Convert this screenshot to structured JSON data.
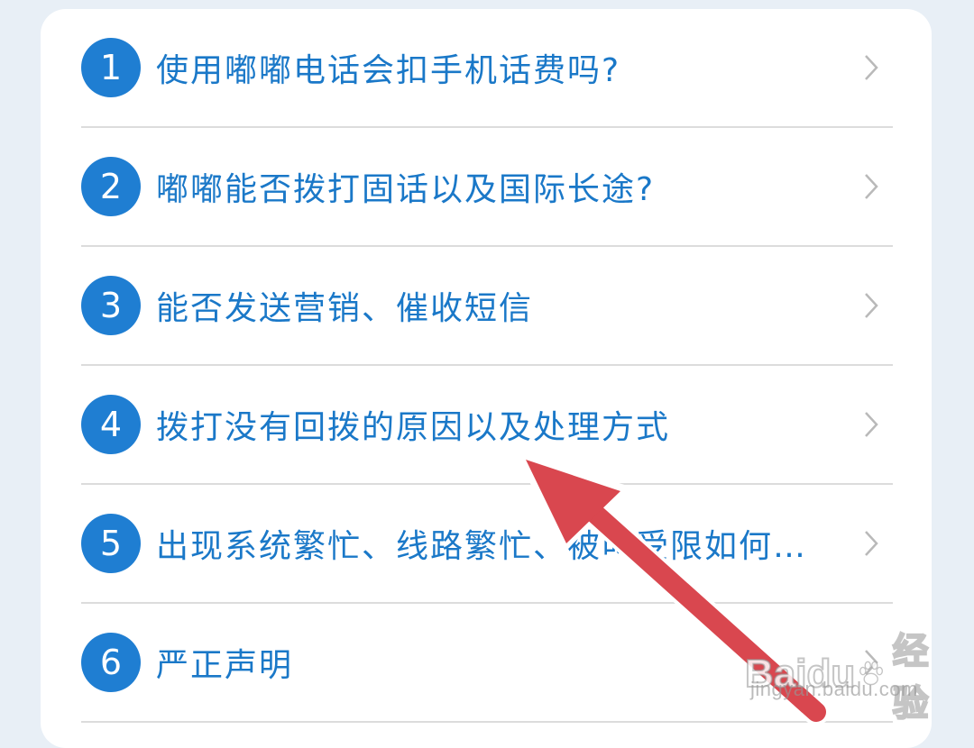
{
  "faq": {
    "items": [
      {
        "number": "1",
        "title": "使用嘟嘟电话会扣手机话费吗?"
      },
      {
        "number": "2",
        "title": "嘟嘟能否拨打固话以及国际长途?"
      },
      {
        "number": "3",
        "title": "能否发送营销、催收短信"
      },
      {
        "number": "4",
        "title": "拨打没有回拨的原因以及处理方式"
      },
      {
        "number": "5",
        "title": "出现系统繁忙、线路繁忙、被叫受限如何…"
      },
      {
        "number": "6",
        "title": "严正声明"
      }
    ]
  },
  "watermark": {
    "logo": "Baidu",
    "cn": "经验",
    "url": "jingyan.baidu.com"
  },
  "colors": {
    "accent": "#1f7ed2",
    "title_text": "#1a78c8",
    "annotation_arrow": "#d9474f",
    "background": "#e8eff6"
  }
}
